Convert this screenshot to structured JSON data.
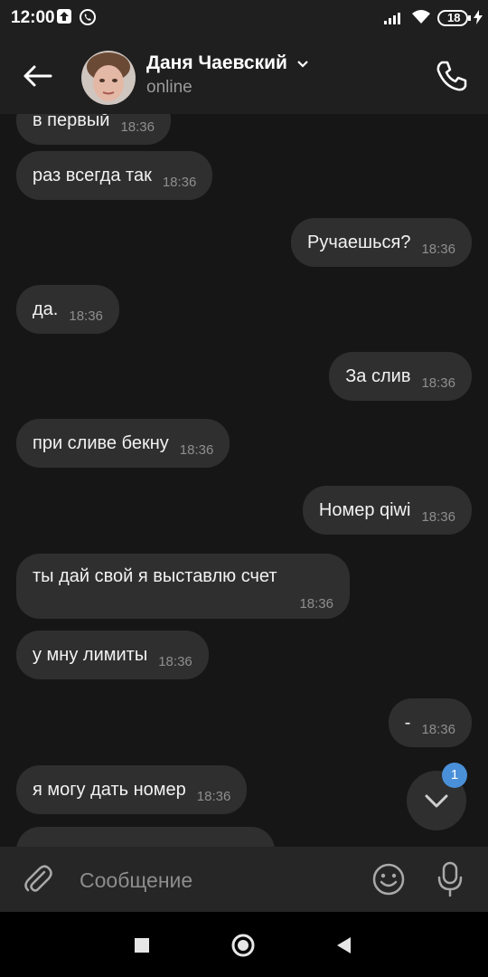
{
  "status_bar": {
    "time": "12:00",
    "battery": "18"
  },
  "header": {
    "contact_name": "Даня Чаевский",
    "status": "online"
  },
  "messages": [
    {
      "side": "in",
      "text": "в первый",
      "time": "18:36"
    },
    {
      "side": "in",
      "text": "раз всегда так",
      "time": "18:36"
    },
    {
      "side": "out",
      "text": "Ручаешься?",
      "time": "18:36"
    },
    {
      "side": "in",
      "text": "да.",
      "time": "18:36"
    },
    {
      "side": "out",
      "text": "За слив",
      "time": "18:36"
    },
    {
      "side": "in",
      "text": "при сливе бекну",
      "time": "18:36"
    },
    {
      "side": "out",
      "text": "Номер qiwi",
      "time": "18:36"
    },
    {
      "side": "in",
      "text": "ты дай свой я выставлю счет",
      "time": "18:36"
    },
    {
      "side": "in",
      "text": "у мну лимиты",
      "time": "18:36"
    },
    {
      "side": "out",
      "text": "-",
      "time": "18:36"
    },
    {
      "side": "in",
      "text": "я могу дать номер",
      "time": "18:36"
    }
  ],
  "scroll_button": {
    "badge": "1"
  },
  "composer": {
    "placeholder": "Сообщение"
  },
  "colors": {
    "background": "#161616",
    "bubble": "#2f2f2f",
    "accent": "#4a90d9",
    "text_secondary": "#8e8e8e"
  },
  "icons": [
    "back-arrow-icon",
    "chevron-down-icon",
    "phone-icon",
    "attach-icon",
    "emoji-icon",
    "mic-icon",
    "chevron-down-icon",
    "nav-square-icon",
    "nav-circle-icon",
    "nav-triangle-icon"
  ]
}
